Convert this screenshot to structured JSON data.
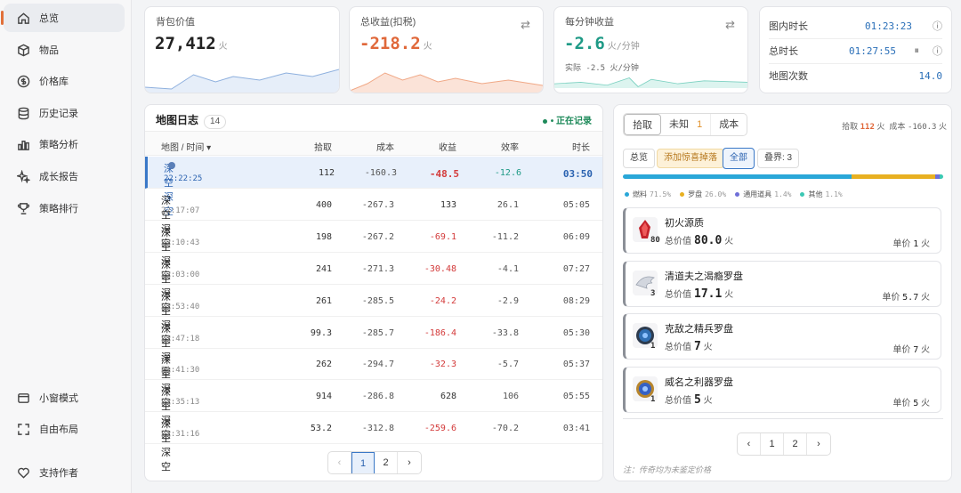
{
  "sidebar": {
    "items": [
      {
        "label": "总览",
        "icon": "home-icon",
        "active": true
      },
      {
        "label": "物品",
        "icon": "box-icon"
      },
      {
        "label": "价格库",
        "icon": "dollar-icon"
      },
      {
        "label": "历史记录",
        "icon": "database-icon"
      },
      {
        "label": "策略分析",
        "icon": "bar-chart-icon"
      },
      {
        "label": "成长报告",
        "icon": "sparkle-icon"
      },
      {
        "label": "策略排行",
        "icon": "trophy-icon"
      }
    ],
    "bottom": [
      {
        "label": "小窗模式",
        "icon": "window-icon"
      },
      {
        "label": "自由布局",
        "icon": "expand-icon"
      },
      {
        "label": "支持作者",
        "icon": "heart-icon"
      }
    ]
  },
  "stats": {
    "bag": {
      "label": "背包价值",
      "value": "27,412",
      "unit": "火"
    },
    "total_income": {
      "label": "总收益(扣税)",
      "value": "-218.2",
      "unit": "火"
    },
    "per_min": {
      "label": "每分钟收益",
      "value": "-2.6",
      "unit": "火/分钟",
      "actual": "实际 -2.5 火/分钟"
    }
  },
  "timers": {
    "in_map_label": "图内时长",
    "in_map_value": "01:23:23",
    "total_label": "总时长",
    "total_value": "01:27:55",
    "maps_label": "地图次数",
    "maps_value": "14.0"
  },
  "log": {
    "title": "地图日志",
    "count": "14",
    "recording": "• 正在记录",
    "headers": {
      "map": "地图 / 时间 ▾",
      "pick": "拾取",
      "cost": "成本",
      "income": "收益",
      "eff": "效率",
      "dur": "时长"
    },
    "rows": [
      {
        "map": "深空 深空",
        "time": "22:22:25",
        "pick": "112",
        "cost": "-160.3",
        "income": "-48.5",
        "eff": "-12.6",
        "dur": "03:50"
      },
      {
        "map": "深空 深空",
        "time": "22:17:07",
        "pick": "400",
        "cost": "-267.3",
        "income": "133",
        "eff": "26.1",
        "dur": "05:05"
      },
      {
        "map": "深空 深空",
        "time": "22:10:43",
        "pick": "198",
        "cost": "-267.2",
        "income": "-69.1",
        "eff": "-11.2",
        "dur": "06:09"
      },
      {
        "map": "深空 深空",
        "time": "22:03:00",
        "pick": "241",
        "cost": "-271.3",
        "income": "-30.48",
        "eff": "-4.1",
        "dur": "07:27"
      },
      {
        "map": "深空 深空",
        "time": "21:53:40",
        "pick": "261",
        "cost": "-285.5",
        "income": "-24.2",
        "eff": "-2.9",
        "dur": "08:29"
      },
      {
        "map": "深空 深空",
        "time": "21:47:18",
        "pick": "99.3",
        "cost": "-285.7",
        "income": "-186.4",
        "eff": "-33.8",
        "dur": "05:30"
      },
      {
        "map": "深空 深空",
        "time": "21:41:30",
        "pick": "262",
        "cost": "-294.7",
        "income": "-32.3",
        "eff": "-5.7",
        "dur": "05:37"
      },
      {
        "map": "深空 深空",
        "time": "21:35:13",
        "pick": "914",
        "cost": "-286.8",
        "income": "628",
        "eff": "106",
        "dur": "05:55"
      },
      {
        "map": "深空 深空",
        "time": "21:31:16",
        "pick": "53.2",
        "cost": "-312.8",
        "income": "-259.6",
        "eff": "-70.2",
        "dur": "03:41"
      }
    ],
    "pager": {
      "prev": "‹",
      "p1": "1",
      "p2": "2",
      "next": "›"
    }
  },
  "drops": {
    "tabs": {
      "pick": "拾取",
      "unknown": "未知",
      "unknown_count": "1",
      "cost": "成本"
    },
    "summary": {
      "pick_label": "拾取",
      "pick_value": "112",
      "pick_unit": "火",
      "cost_label": "成本",
      "cost_value": "-160.3",
      "cost_unit": "火"
    },
    "filters": {
      "overview": "总览",
      "add_fav": "添加惊喜掉落",
      "all": "全部",
      "world": "叠界: 3"
    },
    "legend": [
      {
        "name": "燃料",
        "pct": "71.5%",
        "color": "#2aa7d8"
      },
      {
        "name": "罗盘",
        "pct": "26.0%",
        "color": "#e8b021"
      },
      {
        "name": "通用道具",
        "pct": "1.4%",
        "color": "#6f6fd8"
      },
      {
        "name": "其他",
        "pct": "1.1%",
        "color": "#3cc8b4"
      }
    ],
    "items": [
      {
        "name": "初火源质",
        "count": "80",
        "total_label": "总价值",
        "total": "80.0",
        "total_unit": "火",
        "unit_label": "单价",
        "unit_price": "1",
        "unit_unit": "火",
        "icon": "flame-crystal-icon"
      },
      {
        "name": "清道夫之渴瘾罗盘",
        "count": "3",
        "total_label": "总价值",
        "total": "17.1",
        "total_unit": "火",
        "unit_label": "单价",
        "unit_price": "5.7",
        "unit_unit": "火",
        "icon": "wing-compass-icon"
      },
      {
        "name": "克敌之精兵罗盘",
        "count": "1",
        "total_label": "总价值",
        "total": "7",
        "total_unit": "火",
        "unit_label": "单价",
        "unit_price": "7",
        "unit_unit": "火",
        "icon": "blue-compass-icon"
      },
      {
        "name": "威名之利器罗盘",
        "count": "1",
        "total_label": "总价值",
        "total": "5",
        "total_unit": "火",
        "unit_label": "单价",
        "unit_price": "5",
        "unit_unit": "火",
        "icon": "gold-compass-icon"
      }
    ],
    "pager": {
      "prev": "‹",
      "p1": "1",
      "p2": "2",
      "next": "›"
    },
    "note": "注：传奇均为未鉴定价格"
  }
}
